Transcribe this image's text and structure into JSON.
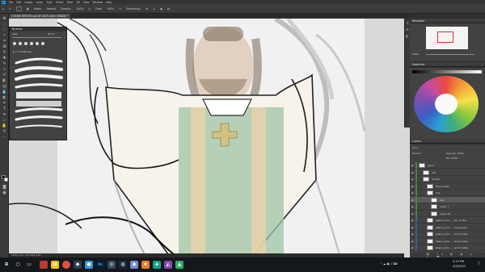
{
  "menubar": {
    "items": [
      "File",
      "Edit",
      "Image",
      "Layer",
      "Type",
      "Select",
      "Filter",
      "3D",
      "View",
      "Window",
      "Help"
    ]
  },
  "options": {
    "mode_label": "Mode:",
    "mode_value": "Normal",
    "opacity_label": "Opacity:",
    "opacity_value": "100%",
    "flow_label": "Flow:",
    "flow_value": "100%",
    "smoothing_label": "Smoothing:"
  },
  "document": {
    "tab_title": "CHARIE REEVES.psd @ 100% (line, RGB/8) *"
  },
  "brush_panel": {
    "title": "Brushes",
    "size_label": "Size:",
    "size_value": "45 px",
    "folder_label": "2 Lettering"
  },
  "navigator": {
    "title": "Navigator",
    "zoom": "100%"
  },
  "swatches": {
    "title": "Swatches"
  },
  "layers": {
    "title": "Layers",
    "kind_label": "Kind",
    "blend_mode": "Normal",
    "opacity_label": "Opacity:",
    "opacity_value": "100%",
    "fill_label": "Fill:",
    "fill_value": "100%",
    "items": [
      {
        "name": "jesus",
        "indent": 0
      },
      {
        "name": "hat",
        "indent": 1
      },
      {
        "name": "thread",
        "indent": 1
      },
      {
        "name": "hand_down",
        "indent": 2
      },
      {
        "name": "line",
        "indent": 2
      },
      {
        "name": "line",
        "indent": 3,
        "selected": true
      },
      {
        "name": "Layer 1",
        "indent": 3
      },
      {
        "name": "Layer 62",
        "indent": 3
      },
      {
        "name": "keanu_arm... ...en_scribe",
        "indent": 2
      },
      {
        "name": "keanu_arm... ...hole_scrib",
        "indent": 2
      },
      {
        "name": "keanu_arm... ...ack to skip",
        "indent": 2
      },
      {
        "name": "keanu_arm... ...ack to skip",
        "indent": 2
      },
      {
        "name": "keanu_arm... ...ack to skip",
        "indent": 2
      }
    ]
  },
  "statusbar": {
    "text": "100%     Doc: 45.1M/1.44G"
  },
  "taskbar": {
    "time": "3:13 PM",
    "date": "2/3/2020"
  },
  "colors": {
    "accent": "#31a8ff",
    "canvas_bg": "#d8d8d8",
    "panel_bg": "#424242"
  }
}
